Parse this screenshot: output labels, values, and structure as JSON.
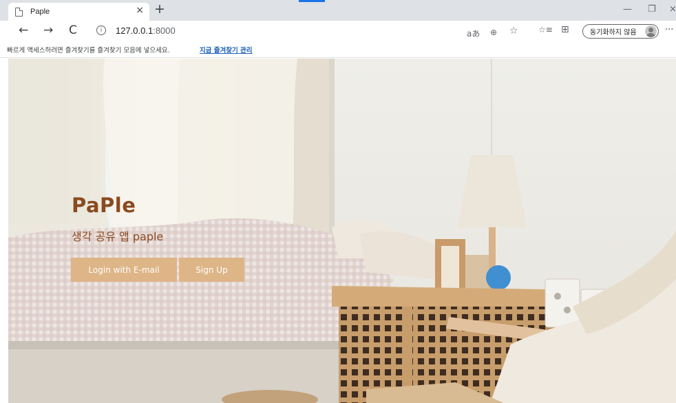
{
  "browser": {
    "tab_title": "Paple",
    "tab_close": "×",
    "new_tab": "+",
    "window_controls": {
      "minimize": "—",
      "restore": "❐",
      "close": "×"
    },
    "nav": {
      "back": "←",
      "forward": "→",
      "reload": "C"
    },
    "url_host": "127.0.0.1",
    "url_port": ":8000",
    "toolbar_icons": {
      "read_aloud": "aあ",
      "zoom": "⊕",
      "add_favorite": "☆",
      "favorites": "☆≡",
      "collections": "⊞"
    },
    "sync_label": "동기화하지 않음",
    "more": "···",
    "favorites_bar_text": "빠르게 액세스하려면 즐겨찾기를 즐겨찾기 모음에 넣으세요.",
    "favorites_bar_link": "지금 즐겨찾기 관리"
  },
  "page": {
    "brand": "PaPle",
    "subtitle": "생각 공유 앱 paple",
    "login_button": "Login with E-mail",
    "signup_button": "Sign Up"
  },
  "colors": {
    "brand_text": "#8a4a1f",
    "button_bg": "#deb587",
    "button_text": "#ffffff",
    "link": "#1a5fb4"
  }
}
